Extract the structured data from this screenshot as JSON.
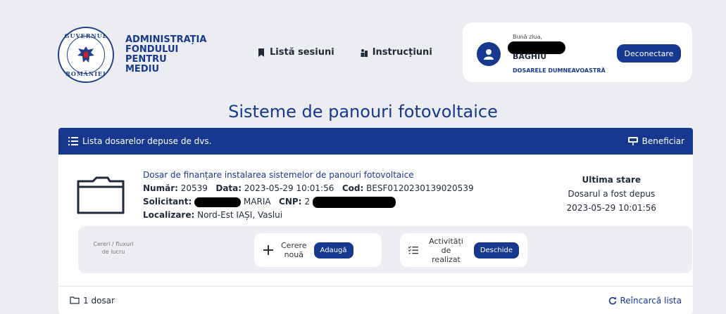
{
  "org": {
    "seal_top_text": "GUVERNUL",
    "seal_bottom_text": "ROMÂNIEI",
    "name_line1": "ADMINISTRAȚIA",
    "name_line2": "FONDULUI",
    "name_line3": "PENTRU MEDIU"
  },
  "nav": {
    "sessions_label": "Listă sesiuni",
    "instructions_label": "Instrucțiuni"
  },
  "user": {
    "greeting": "Bună ziua,",
    "name": "BAGHIU",
    "dosare_link": "DOSARELE DUMNEAVOASTRĂ",
    "logout_label": "Deconectare"
  },
  "page": {
    "title": "Sisteme de panouri fotovoltaice"
  },
  "panel": {
    "header_title": "Lista dosarelor depuse de dvs.",
    "header_role": "Beneficiar"
  },
  "dosar": {
    "title": "Dosar de finanțare instalarea sistemelor de panouri fotovoltaice",
    "numar_label": "Număr:",
    "numar": "20539",
    "data_label": "Data:",
    "data": "2023-05-29 10:01:56",
    "cod_label": "Cod:",
    "cod": "BESF0120230139020539",
    "solicitant_label": "Solicitant:",
    "solicitant_visible": "MARIA",
    "cnp_label": "CNP:",
    "cnp_visible": "2",
    "localizare_label": "Localizare:",
    "localizare": "Nord-Est IAȘI, Vaslui"
  },
  "status": {
    "title": "Ultima stare",
    "text": "Dosarul a fost depus",
    "date": "2023-05-29 10:01:56"
  },
  "workflow": {
    "label_line1": "Cereri / fluxuri",
    "label_line2": "de lucru",
    "request_line1": "Cerere",
    "request_line2": "nouă",
    "request_button": "Adaugă",
    "activities_line1": "Activități de",
    "activities_line2": "realizat",
    "activities_button": "Deschide"
  },
  "footer": {
    "count_label": "1 dosar",
    "reload_label": "Reîncarcă lista"
  },
  "colors": {
    "primary": "#17388f",
    "background": "#ecedf2"
  }
}
